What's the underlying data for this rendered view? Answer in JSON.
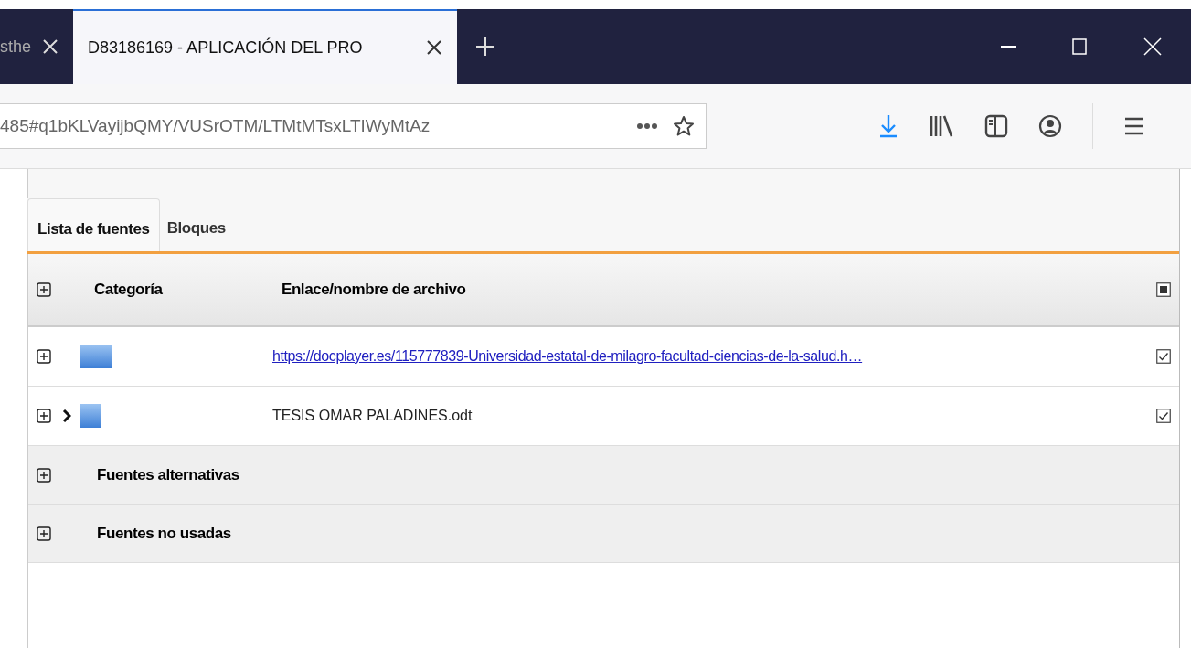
{
  "browser_tabs": [
    {
      "label": "sthe",
      "selected": false
    },
    {
      "label": "D83186169 - APLICACIÓN DEL PRO",
      "selected": true
    }
  ],
  "address_bar": {
    "value": "485#q1bKLVayijbQMY/VUSrOTM/LTMtMTsxLTIWyMtAz"
  },
  "page_tabs": [
    {
      "label": "Lista de fuentes",
      "selected": true
    },
    {
      "label": "Bloques",
      "selected": false
    }
  ],
  "table": {
    "columns": [
      "Categoría",
      "Enlace/nombre de archivo"
    ],
    "select_all": {
      "partial": true
    },
    "rows": [
      {
        "kind": "link",
        "expandable": false,
        "text": "https://docplayer.es/115777839-Universidad-estatal-de-milagro-facultad-ciencias-de-la-salud.h…",
        "checked": true
      },
      {
        "kind": "file",
        "expandable": true,
        "text": "TESIS OMAR PALADINES.odt",
        "checked": true
      }
    ],
    "groups": [
      "Fuentes alternativas",
      "Fuentes no usadas"
    ]
  }
}
